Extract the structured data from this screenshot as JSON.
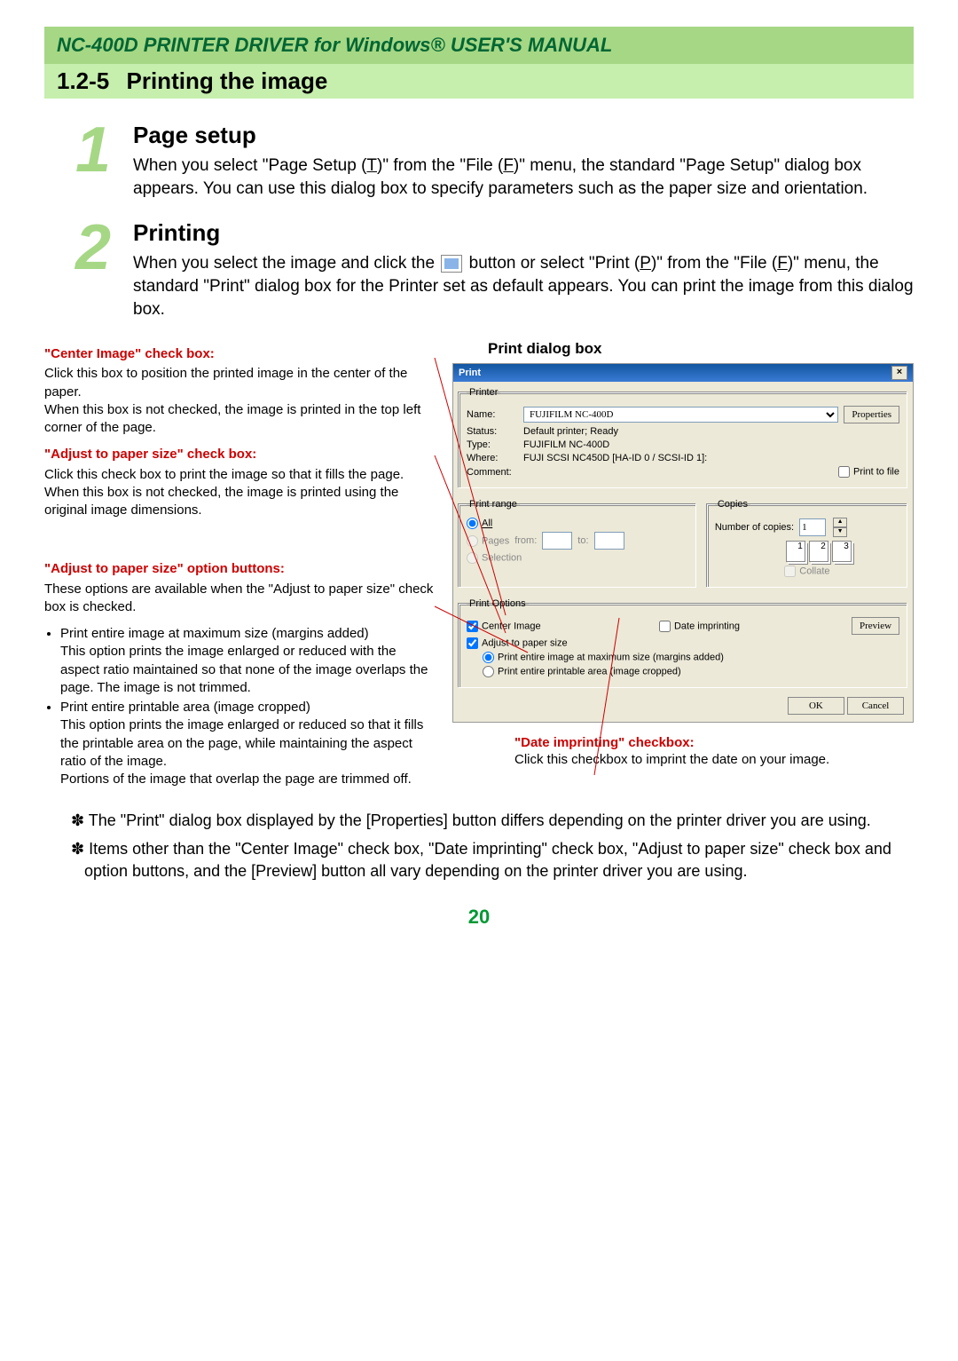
{
  "header": "NC-400D PRINTER DRIVER for Windows® USER'S MANUAL",
  "section_number": "1.2-5",
  "section_title": "Printing the image",
  "step1": {
    "num": "1",
    "head": "Page setup",
    "text_a": "When you select \"Page Setup (",
    "key_a": "T",
    "text_b": ")\" from the \"File (",
    "key_b": "F",
    "text_c": ")\" menu, the standard \"Page Setup\" dialog box appears. You can use this dialog box to specify parameters such as the paper size and orientation."
  },
  "step2": {
    "num": "2",
    "head": "Printing",
    "text_a": "When you select the image and click the ",
    "text_b": " button or select \"Print (",
    "key_b": "P",
    "text_c": ")\" from the \"File (",
    "key_c": "F",
    "text_d": ")\" menu, the standard \"Print\" dialog box for the Printer set as default appears. You can print the image from this dialog box."
  },
  "annotations": {
    "center": {
      "head": "\"Center Image\" check box:",
      "body": "Click this box to position the printed image in the center of the paper.\nWhen this box is not checked, the image is printed in the top left corner of the page."
    },
    "adjust": {
      "head": "\"Adjust to paper size\" check box:",
      "body": "Click this check box to print the image so that it fills the page.\nWhen this box is not checked, the image is printed using the original image dimensions."
    },
    "options": {
      "head": "\"Adjust to paper size\" option buttons:",
      "intro": "These options are available when the \"Adjust to paper size\" check box is checked.",
      "bullet1_head": "Print entire image at maximum size (margins added)",
      "bullet1_body": "This option prints the image enlarged or reduced with the aspect ratio maintained so that none of the image overlaps the page. The image is not trimmed.",
      "bullet2_head": "Print entire printable area (image cropped)",
      "bullet2_body": "This option prints the image enlarged or reduced so that it fills the printable area on the page, while maintaining the aspect ratio of the image.\nPortions of the image that overlap the page are trimmed off."
    },
    "date": {
      "head": "\"Date imprinting\" checkbox:",
      "body": "Click this checkbox to imprint the date on your image."
    }
  },
  "dialog_title_label": "Print dialog box",
  "dialog": {
    "title": "Print",
    "printer_legend": "Printer",
    "name_label": "Name:",
    "name_value": "FUJIFILM NC-400D",
    "properties": "Properties",
    "status_label": "Status:",
    "status_value": "Default printer; Ready",
    "type_label": "Type:",
    "type_value": "FUJIFILM NC-400D",
    "where_label": "Where:",
    "where_value": "FUJI SCSI NC450D [HA-ID 0 / SCSI-ID 1]:",
    "comment_label": "Comment:",
    "print_to_file": "Print to file",
    "range_legend": "Print range",
    "range_all": "All",
    "range_pages": "Pages",
    "range_from": "from:",
    "range_to": "to:",
    "range_selection": "Selection",
    "copies_legend": "Copies",
    "copies_label": "Number of copies:",
    "copies_value": "1",
    "collate": "Collate",
    "options_legend": "Print Options",
    "opt_center": "Center Image",
    "opt_date": "Date imprinting",
    "opt_preview": "Preview",
    "opt_adjust": "Adjust to paper size",
    "opt_radio1": "Print entire image at maximum size (margins added)",
    "opt_radio2": "Print entire printable area (image cropped)",
    "ok": "OK",
    "cancel": "Cancel"
  },
  "notes": {
    "n1": "✽ The \"Print\" dialog box displayed by the [Properties] button differs depending on the printer driver you are using.",
    "n2": "✽ Items other than the \"Center Image\" check box, \"Date imprinting\" check box, \"Adjust to paper size\" check box and option buttons, and the [Preview] button all vary depending on the printer driver you are using."
  },
  "page_number": "20"
}
